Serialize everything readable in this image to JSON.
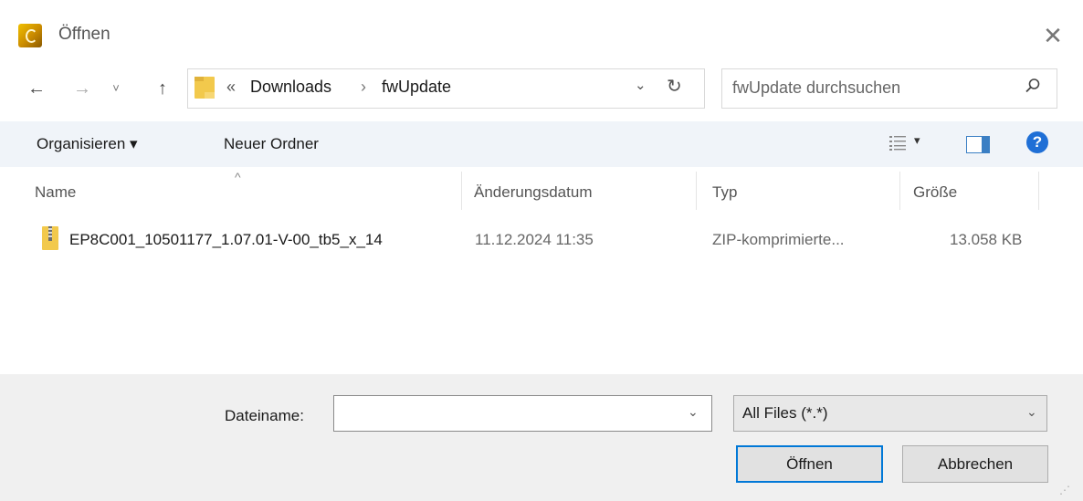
{
  "window": {
    "title": "Öffnen",
    "close": "✕"
  },
  "nav": {
    "back": "←",
    "forward": "→",
    "recent": "˅",
    "up": "↑"
  },
  "address": {
    "overflow": "«",
    "crumbs": [
      "Downloads",
      "fwUpdate"
    ],
    "separator": "›",
    "dropdown": "⌄",
    "refresh": "↻"
  },
  "search": {
    "placeholder": "fwUpdate durchsuchen"
  },
  "toolbar": {
    "organize_label": "Organisieren ▾",
    "new_folder_label": "Neuer Ordner",
    "view_dropdown": "▾",
    "help": "?"
  },
  "list": {
    "sort_indicator": "^",
    "columns": [
      "Name",
      "Änderungsdatum",
      "Typ",
      "Größe"
    ],
    "rows": [
      {
        "name": "EP8C001_10501177_1.07.01-V-00_tb5_x_14",
        "date": "11.12.2024 11:35",
        "type": "ZIP-komprimierte...",
        "size": "13.058 KB"
      }
    ]
  },
  "footer": {
    "filename_label": "Dateiname:",
    "filename_value": "",
    "filename_dropdown": "⌄",
    "filter_value": "All Files (*.*)",
    "filter_dropdown": "⌄",
    "open_label": "Öffnen",
    "cancel_label": "Abbrechen"
  },
  "colors": {
    "accent": "#0078d7",
    "help": "#1f6fd6",
    "commandbar": "#f0f4f9"
  }
}
